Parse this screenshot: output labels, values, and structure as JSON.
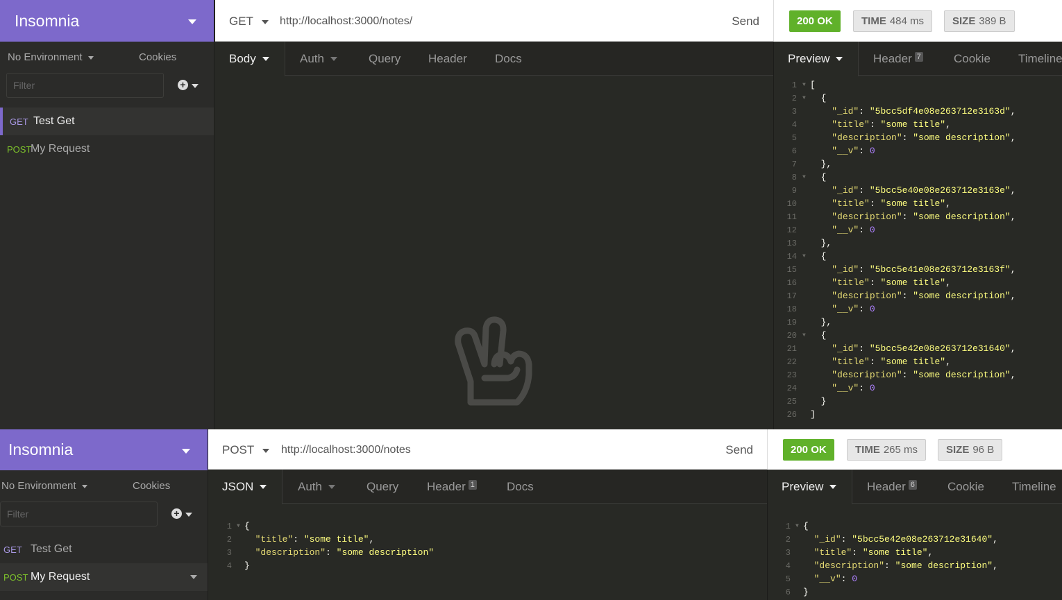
{
  "top": {
    "app_title": "Insomnia",
    "environment": "No Environment",
    "cookies": "Cookies",
    "filter_placeholder": "Filter",
    "requests": [
      {
        "method": "GET",
        "name": "Test Get"
      },
      {
        "method": "POST",
        "name": "My Request"
      }
    ],
    "url_bar": {
      "method": "GET",
      "url": "http://localhost:3000/notes/",
      "send": "Send"
    },
    "status": {
      "code": "200 OK",
      "time_label": "TIME",
      "time_value": "484 ms",
      "size_label": "SIZE",
      "size_value": "389 B"
    },
    "request_tabs": {
      "body": "Body",
      "auth": "Auth",
      "query": "Query",
      "header": "Header",
      "docs": "Docs"
    },
    "response_tabs": {
      "preview": "Preview",
      "header": "Header",
      "header_count": "7",
      "cookie": "Cookie",
      "timeline": "Timeline"
    },
    "response_lines": [
      "[",
      "  {",
      "    \"_id\": \"5bcc5df4e08e263712e3163d\",",
      "    \"title\": \"some title\",",
      "    \"description\": \"some description\",",
      "    \"__v\": 0",
      "  },",
      "  {",
      "    \"_id\": \"5bcc5e40e08e263712e3163e\",",
      "    \"title\": \"some title\",",
      "    \"description\": \"some description\",",
      "    \"__v\": 0",
      "  },",
      "  {",
      "    \"_id\": \"5bcc5e41e08e263712e3163f\",",
      "    \"title\": \"some title\",",
      "    \"description\": \"some description\",",
      "    \"__v\": 0",
      "  },",
      "  {",
      "    \"_id\": \"5bcc5e42e08e263712e31640\",",
      "    \"title\": \"some title\",",
      "    \"description\": \"some description\",",
      "    \"__v\": 0",
      "  }",
      "]"
    ]
  },
  "bottom": {
    "app_title": "Insomnia",
    "environment": "No Environment",
    "cookies": "Cookies",
    "filter_placeholder": "Filter",
    "requests": [
      {
        "method": "GET",
        "name": "Test Get"
      },
      {
        "method": "POST",
        "name": "My Request"
      }
    ],
    "url_bar": {
      "method": "POST",
      "url": "http://localhost:3000/notes",
      "send": "Send"
    },
    "status": {
      "code": "200 OK",
      "time_label": "TIME",
      "time_value": "265 ms",
      "size_label": "SIZE",
      "size_value": "96 B"
    },
    "request_tabs": {
      "body": "JSON",
      "auth": "Auth",
      "query": "Query",
      "header": "Header",
      "header_count": "1",
      "docs": "Docs"
    },
    "response_tabs": {
      "preview": "Preview",
      "header": "Header",
      "header_count": "6",
      "cookie": "Cookie",
      "timeline": "Timeline"
    },
    "body_lines": [
      "{",
      "  \"title\": \"some title\",",
      "  \"description\": \"some description\"",
      "}"
    ],
    "response_lines": [
      "{",
      "  \"_id\": \"5bcc5e42e08e263712e31640\",",
      "  \"title\": \"some title\",",
      "  \"description\": \"some description\",",
      "  \"__v\": 0",
      "}"
    ]
  },
  "colors": {
    "brand": "#7d69cb",
    "ok": "#60b12a",
    "get": "#a797e2",
    "post": "#7ec32b"
  },
  "icons": [
    "caret-down-icon",
    "plus-circle-icon",
    "peace-hand-icon"
  ]
}
